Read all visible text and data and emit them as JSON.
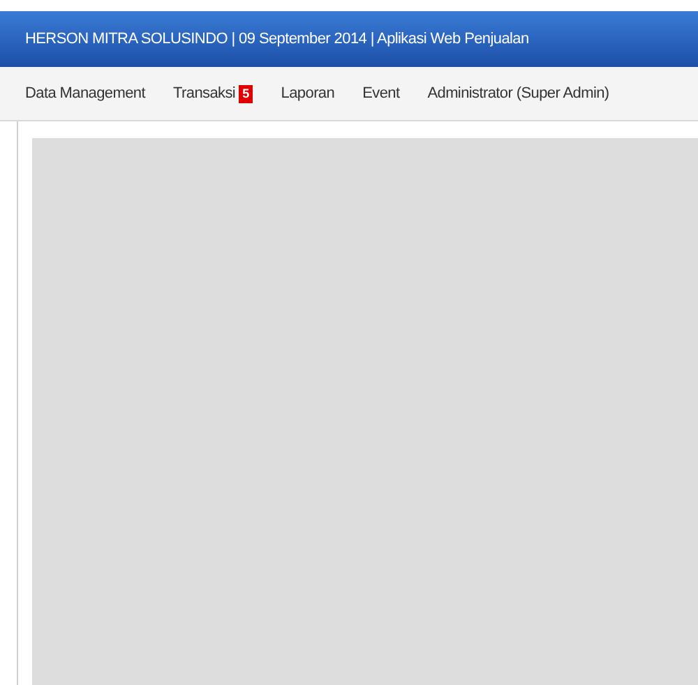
{
  "header": {
    "title": "HERSON MITRA SOLUSINDO | 09 September 2014 | Aplikasi Web Penjualan"
  },
  "menu": [
    {
      "label": "Data Management"
    },
    {
      "label": "Transaksi",
      "badge": "5"
    },
    {
      "label": "Laporan"
    },
    {
      "label": "Event"
    },
    {
      "label": "Administrator (Super Admin)"
    }
  ]
}
